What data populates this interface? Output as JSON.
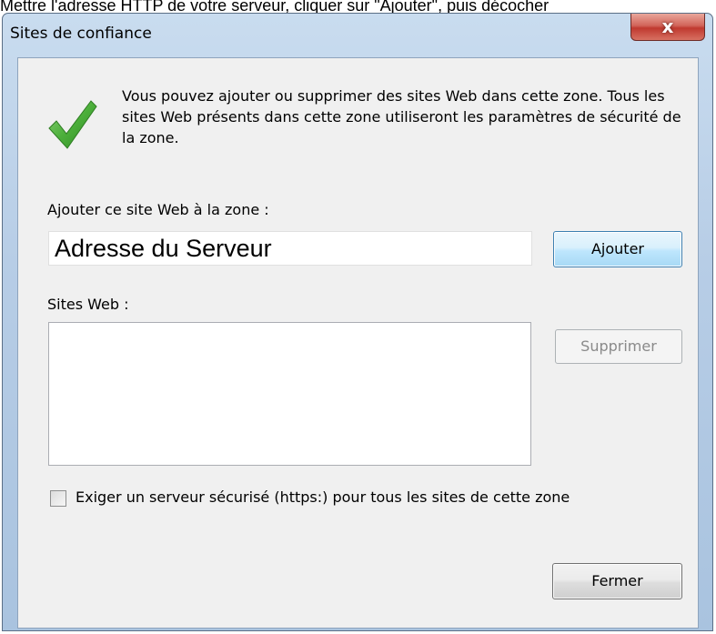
{
  "caption": "Mettre l'adresse HTTP de votre serveur, cliquer sur \"Ajouter\", puis décocher",
  "window": {
    "title": "Sites de confiance",
    "close_glyph": "x"
  },
  "info": {
    "icon": "green-checkmark-icon",
    "text": "Vous pouvez ajouter ou supprimer des sites Web dans cette zone. Tous les sites Web présents dans cette zone utiliseront les paramètres de sécurité de la zone."
  },
  "add_site": {
    "label": "Ajouter ce site Web à la zone :",
    "value": "Adresse du Serveur",
    "button": "Ajouter"
  },
  "sites": {
    "label": "Sites Web :",
    "items": [],
    "remove_button": "Supprimer"
  },
  "https_option": {
    "label": "Exiger un serveur sécurisé (https:) pour tous les sites de cette zone",
    "checked": false
  },
  "close_button": "Fermer",
  "colors": {
    "check_green": "#4caf3b",
    "title_bar": "#b7cde6",
    "close_red": "#c0392f",
    "dialog_bg": "#f0f0f0"
  }
}
